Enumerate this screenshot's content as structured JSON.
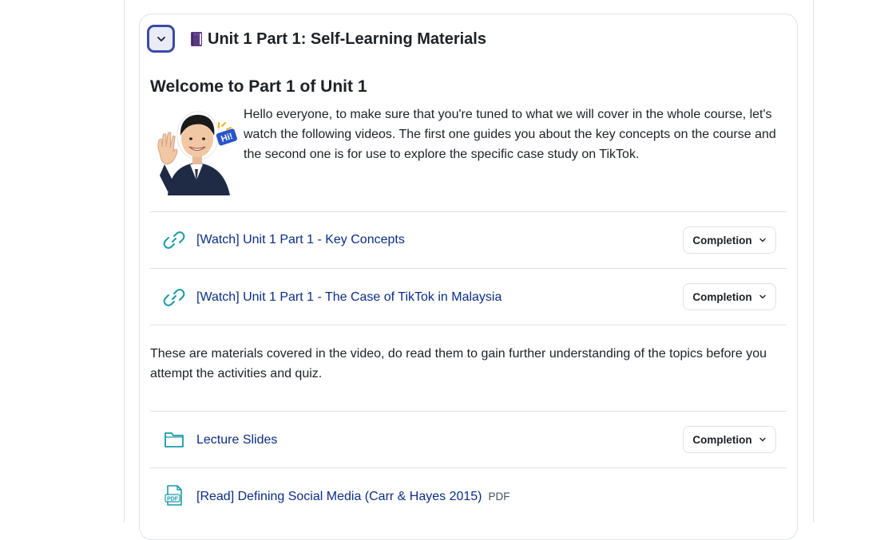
{
  "section": {
    "title": "Unit 1 Part 1: Self-Learning Materials",
    "collapse_icon": "chevron-down-icon",
    "title_icon": "book-icon"
  },
  "welcome": {
    "heading": "Welcome to Part 1 of Unit 1",
    "intro": "Hello everyone, to make sure that you're tuned to what we will cover in the whole course, let's watch the following videos. The first one guides you about the key concepts on the course and the second one is for use to explore the specific case study on TikTok.",
    "avatar_badge": "Hi!"
  },
  "activities": [
    {
      "icon": "link-icon",
      "label": "[Watch] Unit 1 Part 1 - Key Concepts",
      "completion": "Completion"
    },
    {
      "icon": "link-icon",
      "label": "[Watch] Unit 1 Part 1 - The Case of TikTok in Malaysia",
      "completion": "Completion"
    }
  ],
  "materials_note": "These are materials covered in the video, do read them to gain further understanding of the topics before you attempt the activities and quiz.",
  "resources": [
    {
      "icon": "folder-icon",
      "label": "Lecture Slides",
      "completion": "Completion"
    },
    {
      "icon": "pdf-icon",
      "label": "[Read] Defining Social Media (Carr & Hayes 2015)",
      "type": "PDF"
    }
  ],
  "colors": {
    "accent": "#3b4aa5",
    "link": "#0b2d86",
    "icon_teal": "#1a9aa8",
    "border": "#dee2e6"
  }
}
